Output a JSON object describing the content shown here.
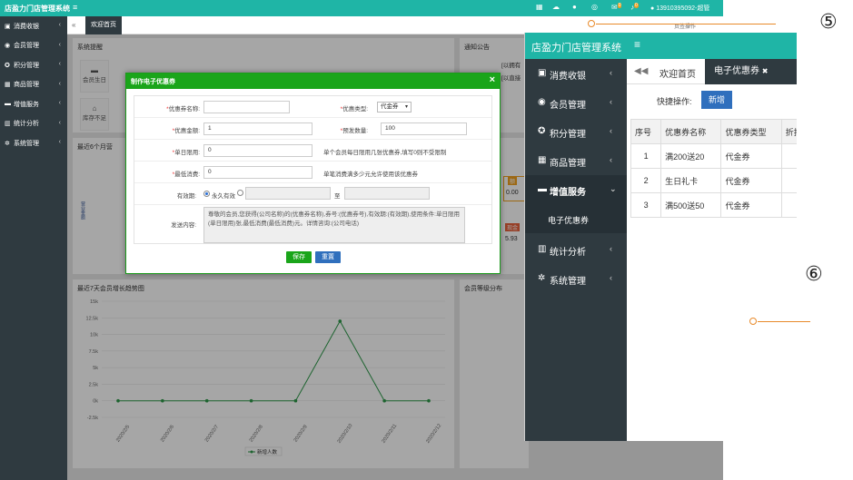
{
  "bg": {
    "app_title": "店盈力门店管理系统",
    "menu_icon": "≡",
    "user": "13910395092-超管",
    "badge1": "0",
    "badge2": "0",
    "sidebar": [
      {
        "icon": "▣",
        "label": "消费收银"
      },
      {
        "icon": "◉",
        "label": "会员管理"
      },
      {
        "icon": "✪",
        "label": "积分管理"
      },
      {
        "icon": "▦",
        "label": "商品管理"
      },
      {
        "icon": "▬",
        "label": "增值服务"
      },
      {
        "icon": "▥",
        "label": "统计分析"
      },
      {
        "icon": "✲",
        "label": "系统管理"
      }
    ],
    "tab": "欢迎首页",
    "page_ops": "页签操作",
    "panel_remind": "系统提醒",
    "remind_cards": [
      "会员生日",
      "库存不足"
    ],
    "panel_notice": "通知公告",
    "notice_lines": [
      "[以拥有",
      "[以直接"
    ],
    "panel_recent6": "最近6个月营",
    "side_axis_label": "营业金额",
    "badge_left": "额",
    "badge_left_value": "0.00",
    "badge_right": "现金",
    "badge_right_value": "5.93",
    "panel_consume_dist": "会员等级分布"
  },
  "chart_data": {
    "type": "line",
    "title": "最近7天会员增长趋势图",
    "x": [
      "2020/2/5",
      "2020/2/6",
      "2020/2/7",
      "2020/2/8",
      "2020/2/9",
      "2020/2/10",
      "2020/2/11",
      "2020/2/12"
    ],
    "series": [
      {
        "name": "新增人数",
        "values": [
          0,
          0,
          0,
          0,
          0,
          12000,
          0,
          0
        ]
      }
    ],
    "y_ticks": [
      "15k",
      "12.5k",
      "10k",
      "7.5k",
      "5k",
      "2.5k",
      "0k",
      "-2.5k"
    ],
    "ylim": [
      -2500,
      15000
    ],
    "legend_position": "bottom-center",
    "color": "#2e9a4a"
  },
  "modal": {
    "title": "制作电子优惠券",
    "close": "×",
    "name_label": "优惠券名称:",
    "name_value": "",
    "type_label": "优惠类型:",
    "type_value": "代金券",
    "amount_label": "优惠金额:",
    "amount_value": "1",
    "presend_label": "预发数量:",
    "presend_value": "100",
    "daily_label": "单日限用:",
    "daily_value": "0",
    "daily_hint": "单个会员每日限用几张优惠券,填写0则不受限制",
    "min_label": "最低消费:",
    "min_value": "0",
    "min_hint": "单笔消费满多少元允许使用该优惠券",
    "valid_label": "有效期:",
    "valid_option1": "永久有效",
    "valid_to": "至",
    "send_label": "发送内容:",
    "send_content": "尊敬的会员,您获得(公司名称)的(优惠券名称),券号:(优惠券号),有效期:(有效期),使用条件:单日限用(单日限用)张,最低消费(最低消费)元。详情咨询:(公司电话)",
    "save": "保存",
    "reset": "重置"
  },
  "zoom": {
    "app_title": "店盈力门店管理系统",
    "menu_icon": "≡",
    "sidebar": [
      {
        "icon": "▣",
        "label": "消费收银"
      },
      {
        "icon": "◉",
        "label": "会员管理"
      },
      {
        "icon": "✪",
        "label": "积分管理"
      },
      {
        "icon": "▦",
        "label": "商品管理"
      },
      {
        "icon": "▬",
        "label": "增值服务"
      },
      {
        "icon": "▥",
        "label": "统计分析"
      },
      {
        "icon": "✲",
        "label": "系统管理"
      }
    ],
    "submenu": "电子优惠券",
    "back": "◀◀",
    "tab1": "欢迎首页",
    "tab2": "电子优惠券",
    "tab2_close": "✖",
    "ops_label": "快捷操作:",
    "new_button": "新增",
    "table_headers": [
      "序号",
      "优惠券名称",
      "优惠券类型",
      "折扣"
    ],
    "rows": [
      [
        "1",
        "满200送20",
        "代金券",
        ""
      ],
      [
        "2",
        "生日礼卡",
        "代金券",
        ""
      ],
      [
        "3",
        "满500送50",
        "代金券",
        ""
      ]
    ]
  },
  "callouts": {
    "five": "⑤",
    "six": "⑥"
  }
}
